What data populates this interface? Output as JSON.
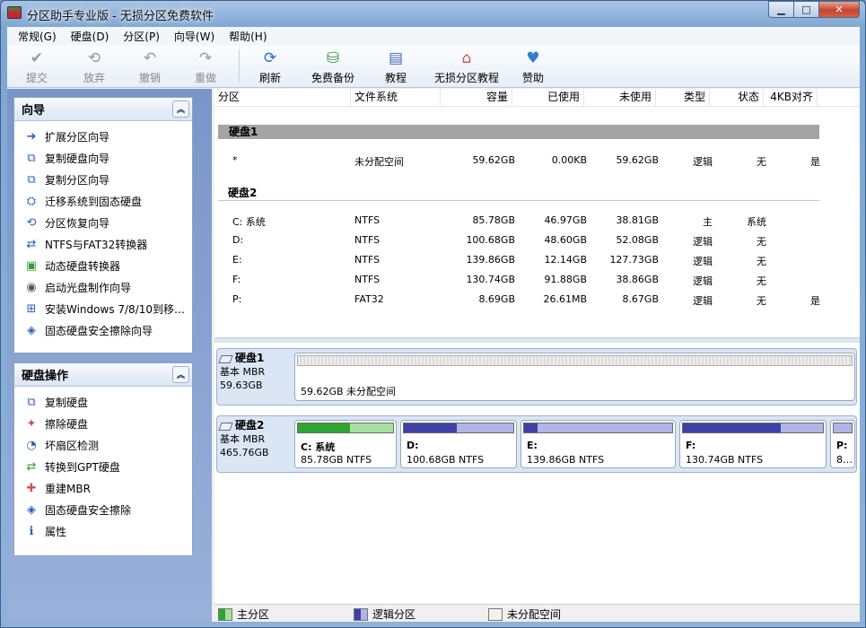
{
  "window": {
    "title": "分区助手专业版 - 无损分区免费软件",
    "min_label": "▁",
    "max_label": "□",
    "close_label": "✕"
  },
  "menu": [
    "常规(G)",
    "硬盘(D)",
    "分区(P)",
    "向导(W)",
    "帮助(H)"
  ],
  "toolbar": {
    "commit": "提交",
    "discard": "放弃",
    "undo": "撤销",
    "redo": "重做",
    "refresh": "刷新",
    "backup": "免费备份",
    "tutorial": "教程",
    "lossless": "无损分区教程",
    "donate": "赞助"
  },
  "wizard_panel": {
    "title": "向导",
    "items": [
      "扩展分区向导",
      "复制硬盘向导",
      "复制分区向导",
      "迁移系统到固态硬盘",
      "分区恢复向导",
      "NTFS与FAT32转换器",
      "动态硬盘转换器",
      "启动光盘制作向导",
      "安装Windows 7/8/10到移…",
      "固态硬盘安全擦除向导"
    ]
  },
  "disk_panel": {
    "title": "硬盘操作",
    "items": [
      "复制硬盘",
      "擦除硬盘",
      "坏扇区检测",
      "转换到GPT硬盘",
      "重建MBR",
      "固态硬盘安全擦除",
      "属性"
    ]
  },
  "columns": [
    "分区",
    "文件系统",
    "容量",
    "已使用",
    "未使用",
    "类型",
    "状态",
    "4KB对齐"
  ],
  "disk1": {
    "label": "硬盘1",
    "rows": [
      [
        "*",
        "未分配空间",
        "59.62GB",
        "0.00KB",
        "59.62GB",
        "逻辑",
        "无",
        "是"
      ]
    ]
  },
  "disk2": {
    "label": "硬盘2",
    "rows": [
      [
        "C: 系统",
        "NTFS",
        "85.78GB",
        "46.97GB",
        "38.81GB",
        "主",
        "系统",
        ""
      ],
      [
        "D:",
        "NTFS",
        "100.68GB",
        "48.60GB",
        "52.08GB",
        "逻辑",
        "无",
        ""
      ],
      [
        "E:",
        "NTFS",
        "139.86GB",
        "12.14GB",
        "127.73GB",
        "逻辑",
        "无",
        ""
      ],
      [
        "F:",
        "NTFS",
        "130.74GB",
        "91.88GB",
        "38.86GB",
        "逻辑",
        "无",
        ""
      ],
      [
        "P:",
        "FAT32",
        "8.69GB",
        "26.61MB",
        "8.67GB",
        "逻辑",
        "无",
        "是"
      ]
    ]
  },
  "diskmap1": {
    "name": "硬盘1",
    "type": "基本 MBR",
    "size": "59.63GB",
    "part_text": "59.62GB 未分配空间"
  },
  "diskmap2": {
    "name": "硬盘2",
    "type": "基本 MBR",
    "size": "465.76GB",
    "parts": [
      {
        "name": "C: 系统",
        "size": "85.78GB NTFS",
        "fill": 0.55,
        "color": "#2ea52e",
        "light": "#a6e0a0"
      },
      {
        "name": "D:",
        "size": "100.68GB NTFS",
        "fill": 0.48,
        "color": "#3c42a6",
        "light": "#b0b4e6"
      },
      {
        "name": "E:",
        "size": "139.86GB NTFS",
        "fill": 0.09,
        "color": "#3c42a6",
        "light": "#b0b4e6"
      },
      {
        "name": "F:",
        "size": "130.74GB NTFS",
        "fill": 0.7,
        "color": "#3c42a6",
        "light": "#b0b4e6"
      },
      {
        "name": "P:",
        "size": "8…",
        "fill": 0.0,
        "color": "#3c42a6",
        "light": "#b0b4e6"
      }
    ]
  },
  "legend": {
    "primary": "主分区",
    "logical": "逻辑分区",
    "unallocated": "未分配空间"
  }
}
